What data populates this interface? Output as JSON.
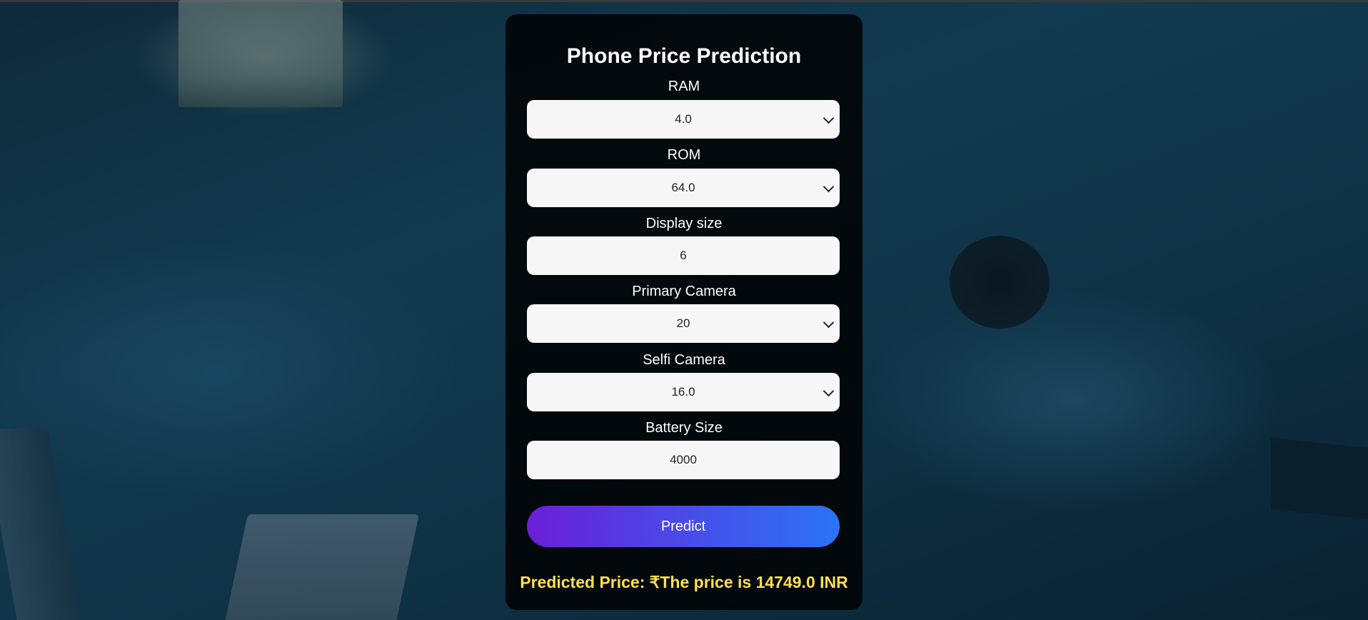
{
  "page": {
    "title": "Phone Price Prediction"
  },
  "form": {
    "fields": [
      {
        "label": "RAM",
        "value": "4.0",
        "type": "select"
      },
      {
        "label": "ROM",
        "value": "64.0",
        "type": "select"
      },
      {
        "label": "Display size",
        "value": "6",
        "type": "input"
      },
      {
        "label": "Primary Camera",
        "value": "20",
        "type": "select"
      },
      {
        "label": "Selfi Camera",
        "value": "16.0",
        "type": "select"
      },
      {
        "label": "Battery Size",
        "value": "4000",
        "type": "input"
      }
    ],
    "predict_label": "Predict"
  },
  "result": {
    "text": "Predicted Price: ₹The price is 14749.0 INR"
  },
  "colors": {
    "card_background": "#000000",
    "field_background": "#f7f7f7",
    "button_gradient_start": "#6a1fd6",
    "button_gradient_end": "#2a74f7",
    "result_text": "#ffe04a"
  },
  "icons": {
    "select_indicator": "chevron-down-icon"
  }
}
